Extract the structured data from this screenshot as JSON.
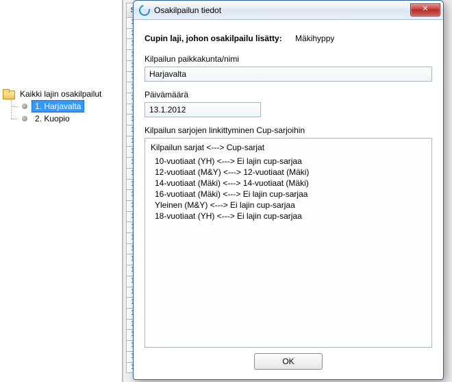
{
  "tree": {
    "root_label": "Kaikki lajin osakilpailut",
    "items": [
      {
        "label": "1. Harjavalta",
        "selected": true
      },
      {
        "label": "2. Kuopio",
        "selected": false
      }
    ]
  },
  "grid": {
    "header": "S",
    "row_prefix": "1"
  },
  "dialog": {
    "title": "Osakilpailun tiedot",
    "close_glyph": "✕",
    "cup_label": "Cupin laji, johon osakilpailu lisätty:",
    "cup_value": "Mäkihyppy",
    "place_label": "Kilpailun paikkakunta/nimi",
    "place_value": "Harjavalta",
    "date_label": "Päivämäärä",
    "date_value": "13.1.2012",
    "link_label": "Kilpailun sarjojen linkittyminen Cup-sarjoihin",
    "link_header": "Kilpailun sarjat  <--->  Cup-sarjat",
    "links": [
      "10-vuotiaat (YH) <--->  Ei lajin cup-sarjaa",
      "12-vuotiaat (M&Y) <--->  12-vuotiaat (Mäki)",
      "14-vuotiaat (Mäki) <--->  14-vuotiaat (Mäki)",
      "16-vuotiaat (Mäki) <--->  Ei lajin cup-sarjaa",
      "Yleinen (M&Y) <--->  Ei lajin cup-sarjaa",
      "18-vuotiaat (YH) <--->  Ei lajin cup-sarjaa"
    ],
    "ok_label": "OK"
  }
}
